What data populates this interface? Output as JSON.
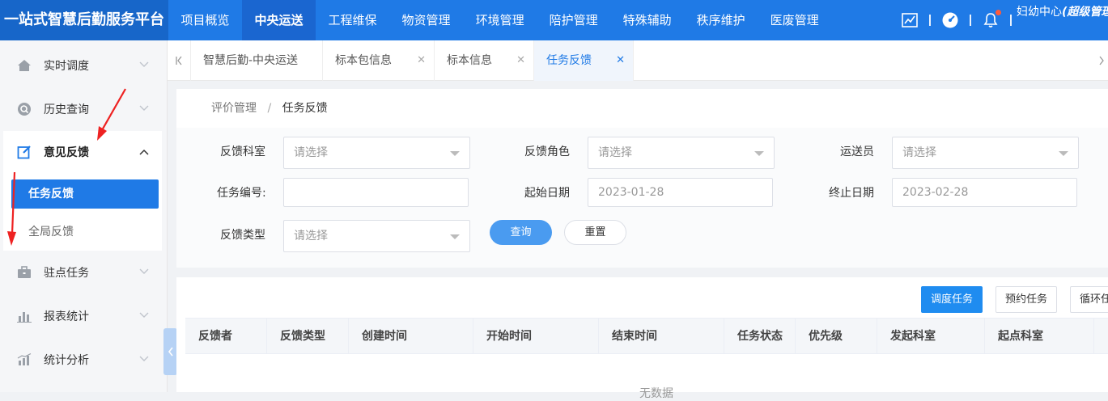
{
  "app": {
    "title": "一站式智慧后勤服务平台"
  },
  "topnav": {
    "items": [
      "项目概览",
      "中央运送",
      "工程维保",
      "物资管理",
      "环境管理",
      "陪护管理",
      "特殊辅助",
      "秩序维护",
      "医废管理"
    ],
    "active": "中央运送"
  },
  "user": {
    "org": "妇幼中心",
    "role": "(超级管理员)"
  },
  "sidebar": {
    "items": [
      "实时调度",
      "历史查询",
      "意见反馈",
      "驻点任务",
      "报表统计",
      "统计分析"
    ],
    "sub": [
      "任务反馈",
      "全局反馈"
    ]
  },
  "tabs": [
    "智慧后勤-中央运送",
    "标本包信息",
    "标本信息",
    "任务反馈"
  ],
  "breadcrumb": {
    "parent": "评价管理",
    "sep": "/",
    "current": "任务反馈"
  },
  "form": {
    "dept_label": "反馈科室",
    "role_label": "反馈角色",
    "courier_label": "运送员",
    "task_no_label": "任务编号:",
    "start_label": "起始日期",
    "end_label": "终止日期",
    "type_label": "反馈类型",
    "placeholder": "请选择",
    "start_date": "2023-01-28",
    "end_date": "2023-02-28",
    "query": "查询",
    "reset": "重置"
  },
  "toolbar": {
    "dispatch": "调度任务",
    "reserve": "预约任务",
    "cycle": "循环任"
  },
  "table": {
    "columns": [
      "反馈者",
      "反馈类型",
      "创建时间",
      "开始时间",
      "结束时间",
      "任务状态",
      "优先级",
      "发起科室",
      "起点科室"
    ],
    "empty": "无数据"
  },
  "colors": {
    "primary": "#1f7ae6",
    "annotation": "#ee2222"
  }
}
